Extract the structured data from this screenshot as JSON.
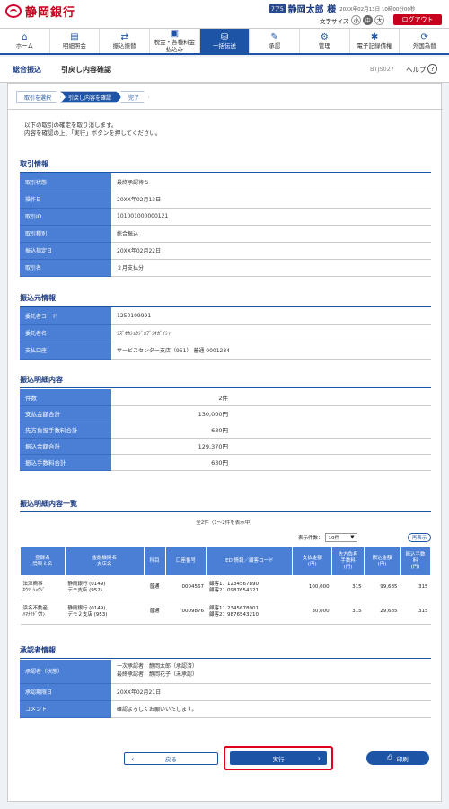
{
  "header": {
    "logo_text": "静岡銀行",
    "user_id_badge": "7ア5",
    "user_name": "静岡太郎 様",
    "last_login": "20XX年02月13日 10時00分00秒",
    "font_size_label": "文字サイズ",
    "font_sizes": [
      "小",
      "中",
      "大"
    ],
    "logout_label": "ログアウト"
  },
  "nav": [
    {
      "label": "ホーム",
      "icon": "home-icon",
      "glyph": "⌂"
    },
    {
      "label": "明細照会",
      "icon": "statement-icon",
      "glyph": "▤"
    },
    {
      "label": "振込振替",
      "icon": "transfer-icon",
      "glyph": "⇄"
    },
    {
      "label": "税金・各種料金\n払込み",
      "icon": "tax-payment-icon",
      "glyph": "▣"
    },
    {
      "label": "一括伝送",
      "icon": "bulk-transmission-icon",
      "glyph": "⛁"
    },
    {
      "label": "承認",
      "icon": "approval-icon",
      "glyph": "✎"
    },
    {
      "label": "管理",
      "icon": "admin-icon",
      "glyph": "⚙"
    },
    {
      "label": "電子記録債権",
      "icon": "e-receivable-icon",
      "glyph": "✱"
    },
    {
      "label": "外国為替",
      "icon": "forex-icon",
      "glyph": "⟳"
    }
  ],
  "titlebar": {
    "category": "総合振込",
    "title": "引戻し内容確認",
    "code": "BTJS027",
    "help_label": "ヘルプ"
  },
  "steps": [
    "取引を選択",
    "引戻し内容を確認",
    "完了"
  ],
  "intro": [
    "以下の取引の確定を取り消します。",
    "内容を確認の上、「実行」ボタンを押してください。"
  ],
  "transaction_info": {
    "title": "取引情報",
    "rows": [
      {
        "label": "取引状態",
        "value": "最終承認待ち"
      },
      {
        "label": "操作日",
        "value": "20XX年02月13日"
      },
      {
        "label": "取引ID",
        "value": "101001000000121"
      },
      {
        "label": "取引種別",
        "value": "総合振込"
      },
      {
        "label": "振込指定日",
        "value": "20XX年02月22日"
      },
      {
        "label": "取引名",
        "value": "２月支払分"
      }
    ]
  },
  "source_info": {
    "title": "振込元情報",
    "rows": [
      {
        "label": "委託者コード",
        "value": "1250109991"
      },
      {
        "label": "委託者名",
        "value": "ｼｽﾞｵｶｼｮｳｼﾞｶﾌﾞｼｷｶﾞｲｼｬ"
      },
      {
        "label": "支払口座",
        "value": "サービスセンター支店（951） 普通 0001234"
      }
    ]
  },
  "summary": {
    "title": "振込明細内容",
    "rows": [
      {
        "label": "件数",
        "value": "2件"
      },
      {
        "label": "支払金額合計",
        "value": "130,000円"
      },
      {
        "label": "先方負担手数料合計",
        "value": "630円"
      },
      {
        "label": "振込金額合計",
        "value": "129,370円"
      },
      {
        "label": "振込手数料合計",
        "value": "630円"
      }
    ]
  },
  "detail_list": {
    "title": "振込明細内容一覧",
    "count_label": "全2件（1～2件を表示中）",
    "per_page_label": "表示件数：",
    "per_page_value": "10件",
    "redisplay_label": "再表示",
    "headers": [
      "登録名\n受取人名",
      "金融機関名\n支店名",
      "科目",
      "口座番号",
      "EDI情報／顧客コード",
      "支払金額\n(円)",
      "先方負担\n手数料\n(円)",
      "振込金額\n(円)",
      "振込手数\n料\n(円)"
    ],
    "rows": [
      {
        "name": "法津商事\nﾎｳﾂﾞｼｮｳｼﾞ",
        "bank": "静岡銀行 (0149)\nデモ支店 (952)",
        "type": "普通",
        "account": "0004567",
        "edi": "顧客1：1234567890\n顧客2：0987654321",
        "amount": "100,000",
        "fee_borne": "315",
        "transfer": "99,685",
        "fee": "315"
      },
      {
        "name": "浜名不動産\nﾊﾏﾅﾌﾄﾞｳｻﾝ",
        "bank": "静岡銀行 (0149)\nデモ２支店 (953)",
        "type": "普通",
        "account": "0009876",
        "edi": "顧客1：2345678901\n顧客2：9876543210",
        "amount": "30,000",
        "fee_borne": "315",
        "transfer": "29,685",
        "fee": "315"
      }
    ]
  },
  "approver_info": {
    "title": "承認者情報",
    "rows": [
      {
        "label": "承認者（状態）",
        "value": "一次承認者：静岡太郎（承認済）\n最終承認者：静岡花子（未承認）"
      },
      {
        "label": "承認期限日",
        "value": "20XX年02月21日"
      },
      {
        "label": "コメント",
        "value": "確認よろしくお願いいたします。"
      }
    ]
  },
  "buttons": {
    "back": "戻る",
    "execute": "実行",
    "print": "印刷"
  },
  "colors": {
    "primary": "#1d54a6",
    "header_cell": "#4b7fd6",
    "brand_red": "#c8001e",
    "highlight": "#e0001e"
  }
}
